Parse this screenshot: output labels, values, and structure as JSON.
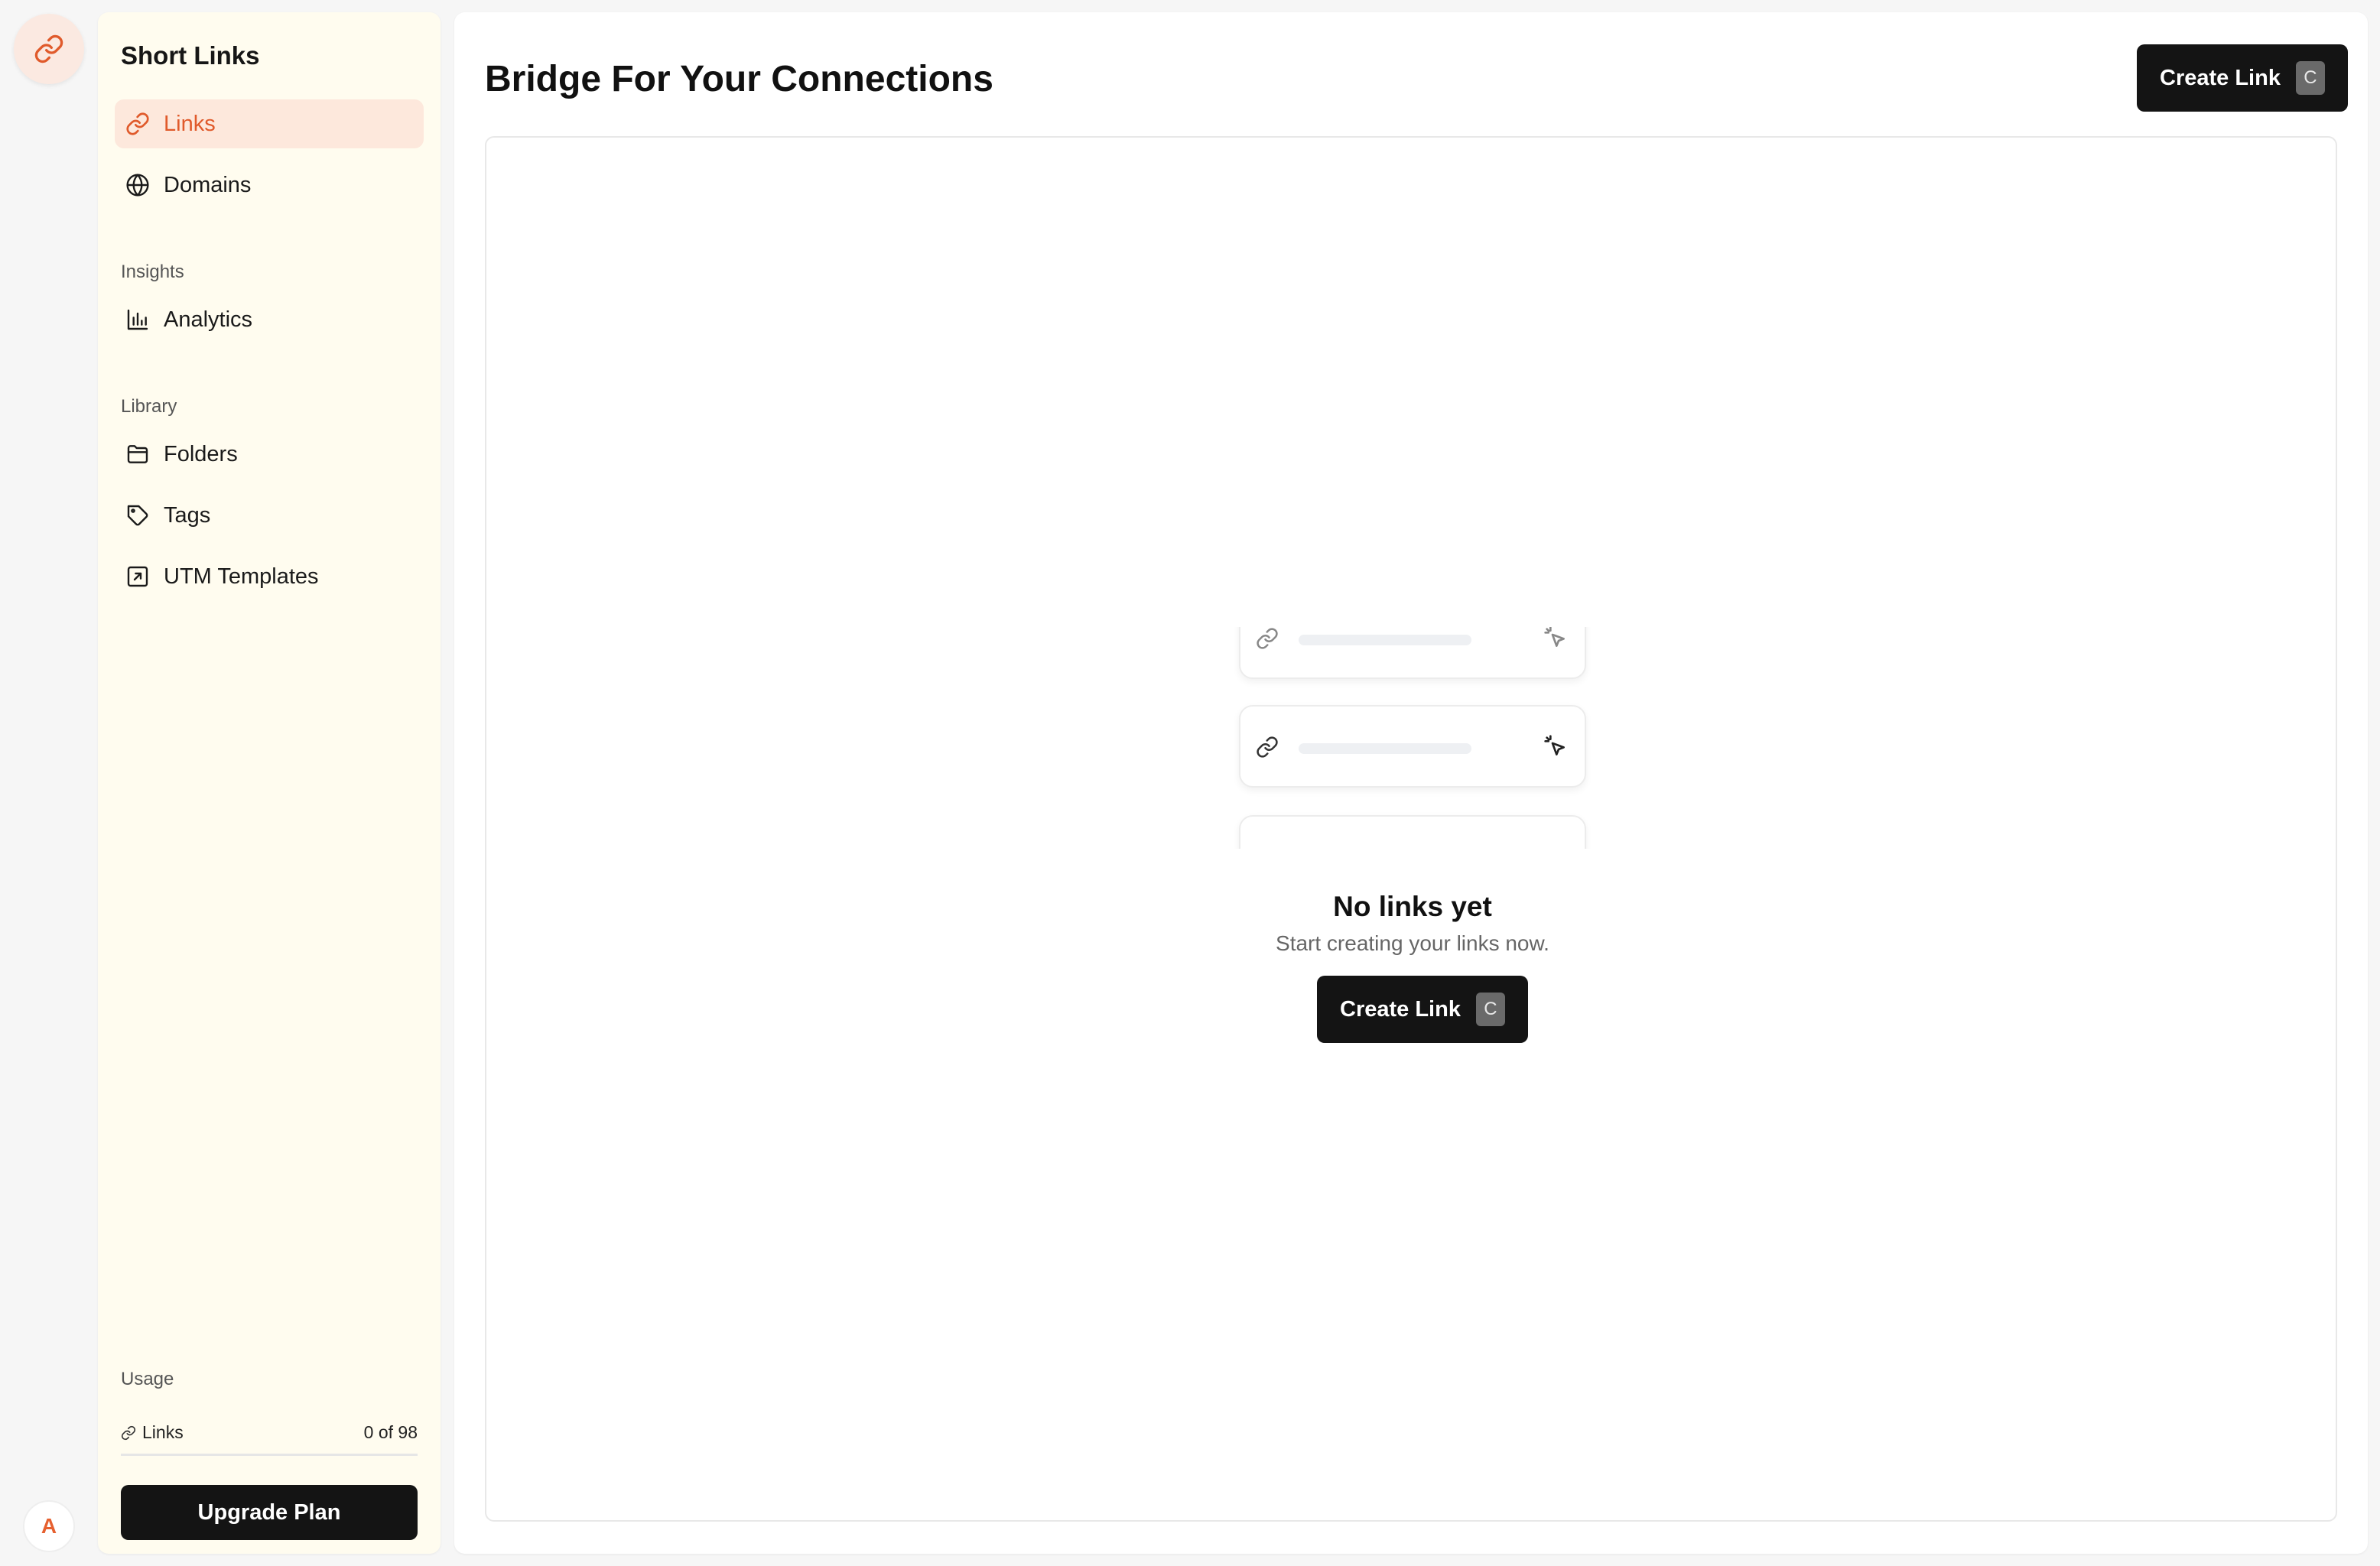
{
  "app": {
    "title": "Short Links",
    "avatar_initial": "A"
  },
  "sidebar": {
    "items": [
      {
        "label": "Links",
        "icon": "link-icon",
        "active": true
      },
      {
        "label": "Domains",
        "icon": "globe-icon"
      }
    ],
    "insights": {
      "heading": "Insights",
      "items": [
        {
          "label": "Analytics",
          "icon": "bar-chart-icon"
        }
      ]
    },
    "library": {
      "heading": "Library",
      "items": [
        {
          "label": "Folders",
          "icon": "folder-icon"
        },
        {
          "label": "Tags",
          "icon": "tag-icon"
        },
        {
          "label": "UTM Templates",
          "icon": "external-square-icon"
        }
      ]
    },
    "usage": {
      "heading": "Usage",
      "label": "Links",
      "value": "0 of 98"
    },
    "upgrade_label": "Upgrade Plan"
  },
  "main": {
    "title": "Bridge For Your Connections",
    "create_label": "Create Link",
    "shortcut": "C",
    "empty": {
      "title": "No links yet",
      "subtitle": "Start creating your links now.",
      "button_label": "Create Link",
      "shortcut": "C"
    }
  },
  "colors": {
    "accent": "#e05a2b",
    "active_bg": "#fde8dc",
    "sidebar_bg": "#fffcef",
    "button_dark": "#141414"
  }
}
